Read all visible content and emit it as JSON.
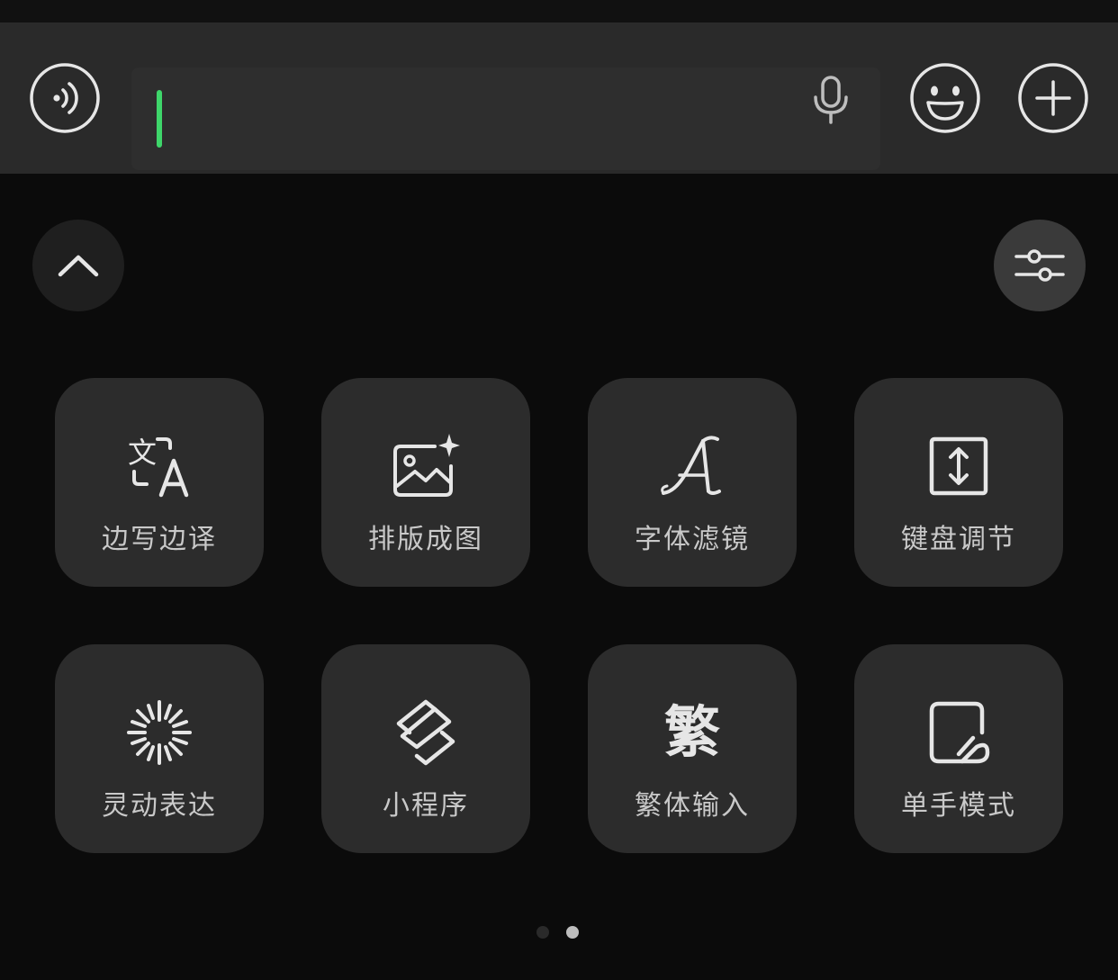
{
  "input_bar": {
    "text_value": "",
    "caret_color": "#3ed66a"
  },
  "icons": {
    "voice": "voice-wave-icon",
    "mic": "microphone-icon",
    "emoji": "smiley-face-icon",
    "plus": "plus-circle-icon",
    "collapse": "chevron-up-icon",
    "settings": "sliders-icon"
  },
  "tiles": [
    {
      "label": "边写边译",
      "icon": "translate-icon"
    },
    {
      "label": "排版成图",
      "icon": "image-sparkle-icon"
    },
    {
      "label": "字体滤镜",
      "icon": "script-font-icon"
    },
    {
      "label": "键盘调节",
      "icon": "resize-vertical-icon"
    },
    {
      "label": "灵动表达",
      "icon": "burst-icon"
    },
    {
      "label": "小程序",
      "icon": "mini-program-icon"
    },
    {
      "label": "繁体输入",
      "icon": "traditional-char-icon",
      "glyph": "繁"
    },
    {
      "label": "单手模式",
      "icon": "one-hand-icon"
    }
  ],
  "pagination": {
    "total": 2,
    "current": 2
  }
}
